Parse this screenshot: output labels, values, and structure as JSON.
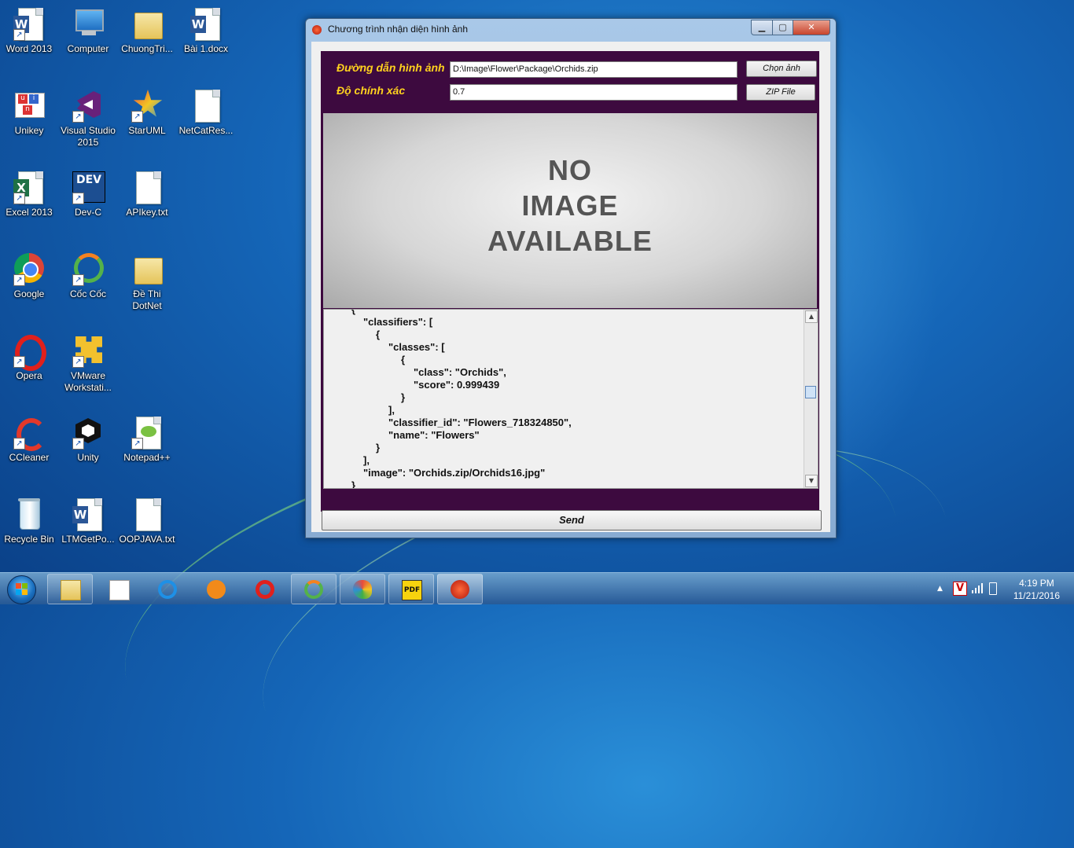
{
  "desktop": {
    "icons": [
      {
        "label": "Word 2013",
        "icon": "word-icon"
      },
      {
        "label": "Computer",
        "icon": "computer-icon"
      },
      {
        "label": "ChuongTri...",
        "icon": "folder-icon"
      },
      {
        "label": "Bài 1.docx",
        "icon": "word-doc-icon"
      },
      {
        "label": "Unikey",
        "icon": "unikey-icon"
      },
      {
        "label": "Visual Studio 2015",
        "icon": "visual-studio-icon"
      },
      {
        "label": "StarUML",
        "icon": "staruml-icon"
      },
      {
        "label": "NetCatRes...",
        "icon": "text-file-icon"
      },
      {
        "label": "Excel 2013",
        "icon": "excel-icon"
      },
      {
        "label": "Dev-C",
        "icon": "devc-icon"
      },
      {
        "label": "APIkey.txt",
        "icon": "text-file-icon"
      },
      {
        "label": "Google",
        "icon": "chrome-icon"
      },
      {
        "label": "Cốc Cốc",
        "icon": "coccoc-icon"
      },
      {
        "label": "Đề Thi DotNet",
        "icon": "folder-icon"
      },
      {
        "label": "Opera",
        "icon": "opera-icon"
      },
      {
        "label": "VMware Workstati...",
        "icon": "vmware-icon"
      },
      {
        "label": "CCleaner",
        "icon": "ccleaner-icon"
      },
      {
        "label": "Unity",
        "icon": "unity-icon"
      },
      {
        "label": "Notepad++",
        "icon": "notepadpp-icon"
      },
      {
        "label": "Recycle Bin",
        "icon": "recycle-bin-icon"
      },
      {
        "label": "LTMGetPo...",
        "icon": "word-doc-icon"
      },
      {
        "label": "OOPJAVA.txt",
        "icon": "text-file-icon"
      }
    ]
  },
  "window": {
    "title": "Chương trình nhận diện hình ảnh",
    "path_label": "Đường dẫn hình ảnh",
    "path_value": "D:\\Image\\Flower\\Package\\Orchids.zip",
    "choose_button": "Chọn ảnh",
    "accuracy_label": "Độ chính xác",
    "accuracy_value": "0.7",
    "zip_button": "ZIP File",
    "placeholder_image": {
      "line1": "NO",
      "line2": "IMAGE",
      "line3": "AVAILABLE"
    },
    "json_lines": [
      "{",
      "\"classifiers\": [",
      "{",
      "\"classes\": [",
      "{",
      "\"class\": \"Orchids\",",
      "\"score\": 0.999439",
      "}",
      "],",
      "\"classifier_id\": \"Flowers_718324850\",",
      "\"name\": \"Flowers\"",
      "}",
      "],",
      "\"image\": \"Orchids.zip/Orchids16.jpg\"",
      "}"
    ],
    "send_button": "Send"
  },
  "taskbar": {
    "pinned": [
      "explorer",
      "unikey",
      "internet-explorer",
      "media-player",
      "opera",
      "coccoc",
      "paint",
      "pdf-reader",
      "image-recognition-app"
    ],
    "time": "4:19 PM",
    "date": "11/21/2016"
  },
  "colors": {
    "panel_bg": "#3d0a3f",
    "label_yellow": "#ffd21e",
    "desktop_blue": "#1566b8"
  }
}
